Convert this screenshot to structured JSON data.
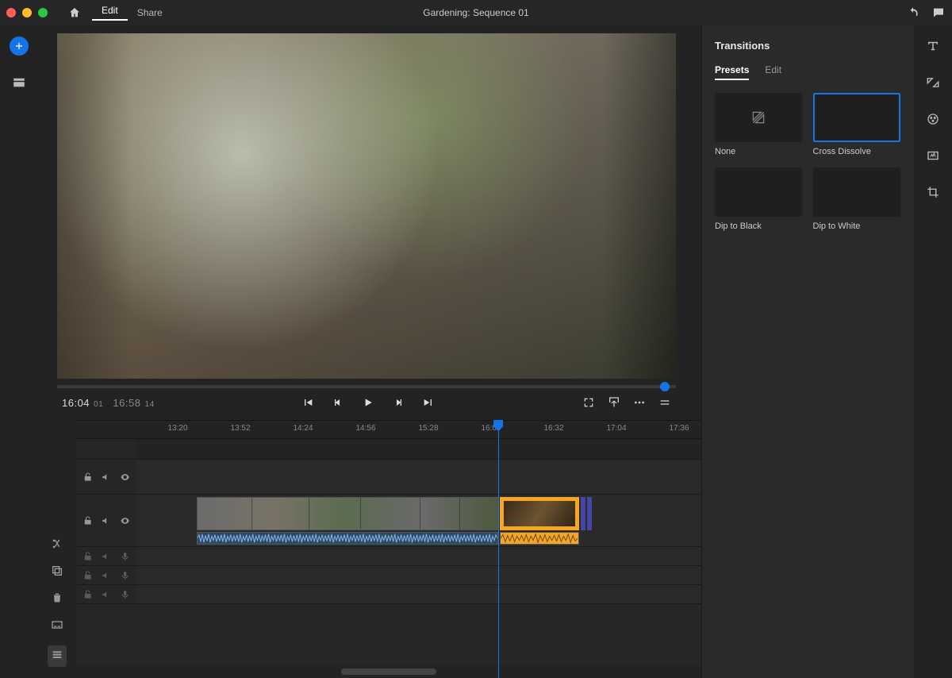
{
  "menubar": {
    "edit": "Edit",
    "share": "Share",
    "title": "Gardening: Sequence 01"
  },
  "player": {
    "current_tc": "16:04",
    "current_frames": "01",
    "duration_tc": "16:58",
    "duration_frames": "14"
  },
  "ruler": {
    "ticks": [
      "13:20",
      "13:52",
      "14:24",
      "14:56",
      "15:28",
      "16:00",
      "16:32",
      "17:04",
      "17:36"
    ]
  },
  "panel": {
    "title": "Transitions",
    "tab_presets": "Presets",
    "tab_edit": "Edit",
    "none": "None",
    "cross": "Cross Dissolve",
    "dtb": "Dip to Black",
    "dtw": "Dip to White"
  }
}
